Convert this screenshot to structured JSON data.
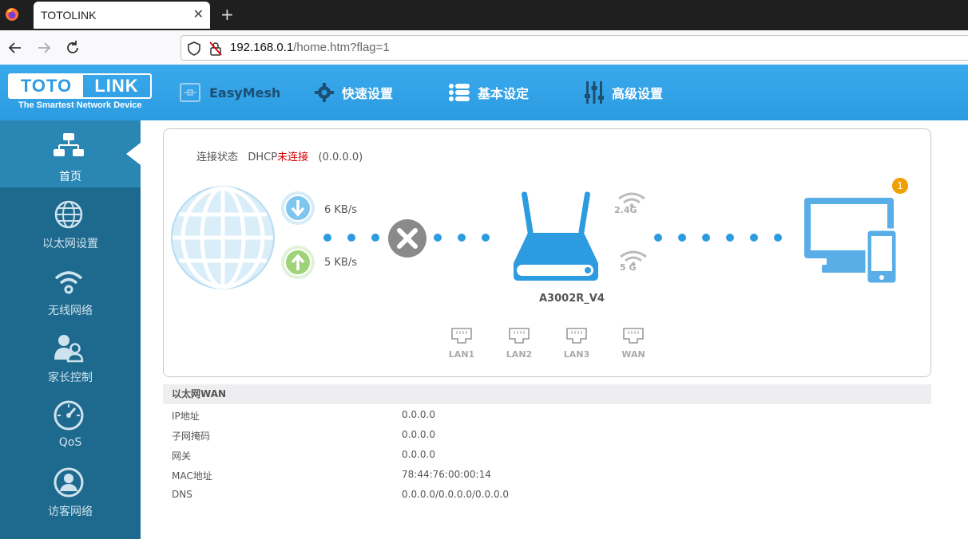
{
  "browser": {
    "tab_title": "TOTOLINK",
    "url_host": "192.168.0.1",
    "url_path": "/home.htm?flag=1"
  },
  "header": {
    "logo_left": "TOTO",
    "logo_right": "LINK",
    "logo_tagline": "The Smartest Network Device",
    "nav": [
      {
        "label": "EasyMesh",
        "icon": "easymesh-icon"
      },
      {
        "label": "快速设置",
        "icon": "gear-icon"
      },
      {
        "label": "基本设定",
        "icon": "list-icon"
      },
      {
        "label": "高级设置",
        "icon": "sliders-icon"
      }
    ]
  },
  "sidebar": {
    "items": [
      {
        "label": "首页",
        "icon": "network-topology-icon",
        "active": true
      },
      {
        "label": "以太网设置",
        "icon": "globe-icon"
      },
      {
        "label": "无线网络",
        "icon": "wifi-icon"
      },
      {
        "label": "家长控制",
        "icon": "parents-icon"
      },
      {
        "label": "QoS",
        "icon": "speedometer-icon"
      },
      {
        "label": "访客网络",
        "icon": "guest-icon"
      }
    ]
  },
  "status": {
    "prefix": "连接状态   DHCP",
    "state": "未连接",
    "ip": "(0.0.0.0)",
    "download": "6 KB/s",
    "upload": "5 KB/s",
    "router_model": "A3002R_V4",
    "band_24": "2.4G",
    "band_5": "5 G",
    "client_count": "1",
    "ports": [
      "LAN1",
      "LAN2",
      "LAN3",
      "WAN"
    ]
  },
  "wan_info": {
    "title": "以太网WAN",
    "rows": [
      {
        "key": "IP地址",
        "value": "0.0.0.0"
      },
      {
        "key": "子网掩码",
        "value": "0.0.0.0"
      },
      {
        "key": "网关",
        "value": "0.0.0.0"
      },
      {
        "key": "MAC地址",
        "value": "78:44:76:00:00:14"
      },
      {
        "key": "DNS",
        "value": "0.0.0.0/0.0.0.0/0.0.0.0"
      }
    ]
  },
  "colors": {
    "header_blue": "#2c9be0",
    "sidebar": "#1e6a8e",
    "sidebar_active": "#2a87b4",
    "disconnected_red": "#d40000",
    "badge_orange": "#f0a000"
  }
}
